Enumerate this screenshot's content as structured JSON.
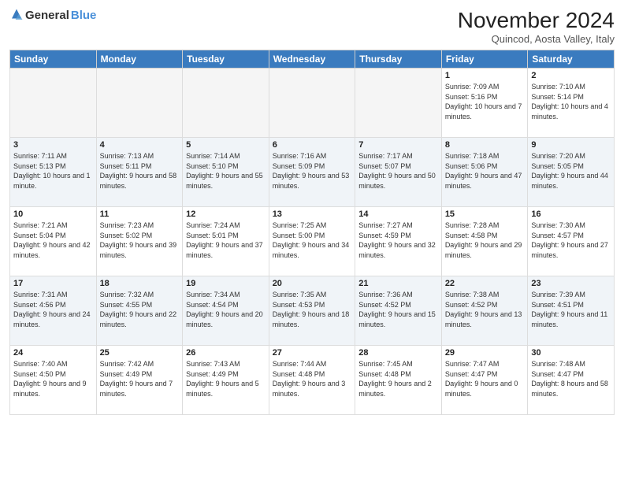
{
  "logo": {
    "general": "General",
    "blue": "Blue"
  },
  "header": {
    "month": "November 2024",
    "location": "Quincod, Aosta Valley, Italy"
  },
  "weekdays": [
    "Sunday",
    "Monday",
    "Tuesday",
    "Wednesday",
    "Thursday",
    "Friday",
    "Saturday"
  ],
  "weeks": [
    [
      {
        "day": "",
        "info": ""
      },
      {
        "day": "",
        "info": ""
      },
      {
        "day": "",
        "info": ""
      },
      {
        "day": "",
        "info": ""
      },
      {
        "day": "",
        "info": ""
      },
      {
        "day": "1",
        "info": "Sunrise: 7:09 AM\nSunset: 5:16 PM\nDaylight: 10 hours and 7 minutes."
      },
      {
        "day": "2",
        "info": "Sunrise: 7:10 AM\nSunset: 5:14 PM\nDaylight: 10 hours and 4 minutes."
      }
    ],
    [
      {
        "day": "3",
        "info": "Sunrise: 7:11 AM\nSunset: 5:13 PM\nDaylight: 10 hours and 1 minute."
      },
      {
        "day": "4",
        "info": "Sunrise: 7:13 AM\nSunset: 5:11 PM\nDaylight: 9 hours and 58 minutes."
      },
      {
        "day": "5",
        "info": "Sunrise: 7:14 AM\nSunset: 5:10 PM\nDaylight: 9 hours and 55 minutes."
      },
      {
        "day": "6",
        "info": "Sunrise: 7:16 AM\nSunset: 5:09 PM\nDaylight: 9 hours and 53 minutes."
      },
      {
        "day": "7",
        "info": "Sunrise: 7:17 AM\nSunset: 5:07 PM\nDaylight: 9 hours and 50 minutes."
      },
      {
        "day": "8",
        "info": "Sunrise: 7:18 AM\nSunset: 5:06 PM\nDaylight: 9 hours and 47 minutes."
      },
      {
        "day": "9",
        "info": "Sunrise: 7:20 AM\nSunset: 5:05 PM\nDaylight: 9 hours and 44 minutes."
      }
    ],
    [
      {
        "day": "10",
        "info": "Sunrise: 7:21 AM\nSunset: 5:04 PM\nDaylight: 9 hours and 42 minutes."
      },
      {
        "day": "11",
        "info": "Sunrise: 7:23 AM\nSunset: 5:02 PM\nDaylight: 9 hours and 39 minutes."
      },
      {
        "day": "12",
        "info": "Sunrise: 7:24 AM\nSunset: 5:01 PM\nDaylight: 9 hours and 37 minutes."
      },
      {
        "day": "13",
        "info": "Sunrise: 7:25 AM\nSunset: 5:00 PM\nDaylight: 9 hours and 34 minutes."
      },
      {
        "day": "14",
        "info": "Sunrise: 7:27 AM\nSunset: 4:59 PM\nDaylight: 9 hours and 32 minutes."
      },
      {
        "day": "15",
        "info": "Sunrise: 7:28 AM\nSunset: 4:58 PM\nDaylight: 9 hours and 29 minutes."
      },
      {
        "day": "16",
        "info": "Sunrise: 7:30 AM\nSunset: 4:57 PM\nDaylight: 9 hours and 27 minutes."
      }
    ],
    [
      {
        "day": "17",
        "info": "Sunrise: 7:31 AM\nSunset: 4:56 PM\nDaylight: 9 hours and 24 minutes."
      },
      {
        "day": "18",
        "info": "Sunrise: 7:32 AM\nSunset: 4:55 PM\nDaylight: 9 hours and 22 minutes."
      },
      {
        "day": "19",
        "info": "Sunrise: 7:34 AM\nSunset: 4:54 PM\nDaylight: 9 hours and 20 minutes."
      },
      {
        "day": "20",
        "info": "Sunrise: 7:35 AM\nSunset: 4:53 PM\nDaylight: 9 hours and 18 minutes."
      },
      {
        "day": "21",
        "info": "Sunrise: 7:36 AM\nSunset: 4:52 PM\nDaylight: 9 hours and 15 minutes."
      },
      {
        "day": "22",
        "info": "Sunrise: 7:38 AM\nSunset: 4:52 PM\nDaylight: 9 hours and 13 minutes."
      },
      {
        "day": "23",
        "info": "Sunrise: 7:39 AM\nSunset: 4:51 PM\nDaylight: 9 hours and 11 minutes."
      }
    ],
    [
      {
        "day": "24",
        "info": "Sunrise: 7:40 AM\nSunset: 4:50 PM\nDaylight: 9 hours and 9 minutes."
      },
      {
        "day": "25",
        "info": "Sunrise: 7:42 AM\nSunset: 4:49 PM\nDaylight: 9 hours and 7 minutes."
      },
      {
        "day": "26",
        "info": "Sunrise: 7:43 AM\nSunset: 4:49 PM\nDaylight: 9 hours and 5 minutes."
      },
      {
        "day": "27",
        "info": "Sunrise: 7:44 AM\nSunset: 4:48 PM\nDaylight: 9 hours and 3 minutes."
      },
      {
        "day": "28",
        "info": "Sunrise: 7:45 AM\nSunset: 4:48 PM\nDaylight: 9 hours and 2 minutes."
      },
      {
        "day": "29",
        "info": "Sunrise: 7:47 AM\nSunset: 4:47 PM\nDaylight: 9 hours and 0 minutes."
      },
      {
        "day": "30",
        "info": "Sunrise: 7:48 AM\nSunset: 4:47 PM\nDaylight: 8 hours and 58 minutes."
      }
    ]
  ]
}
